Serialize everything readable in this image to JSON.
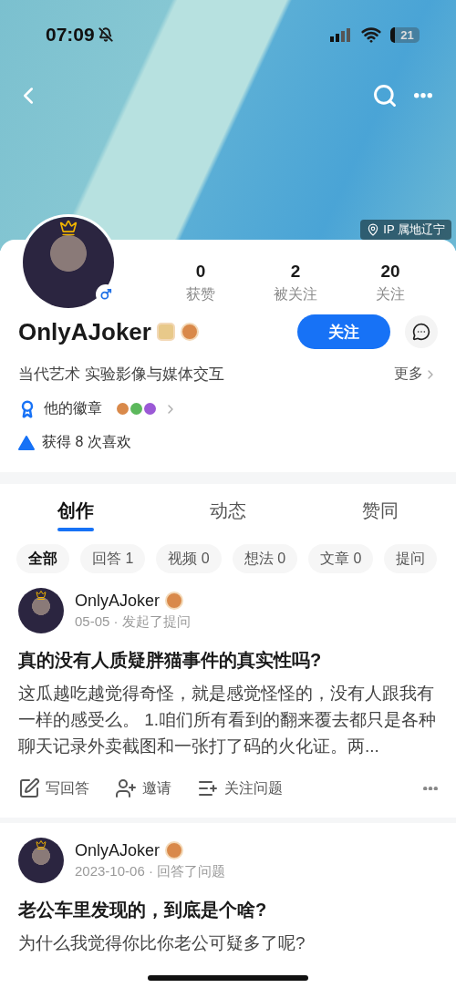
{
  "status_bar": {
    "time": "07:09",
    "battery": "21"
  },
  "ip_location": "IP 属地辽宁",
  "stats": [
    {
      "value": "0",
      "label": "获赞"
    },
    {
      "value": "2",
      "label": "被关注"
    },
    {
      "value": "20",
      "label": "关注"
    }
  ],
  "profile": {
    "name": "OnlyAJoker",
    "follow_button": "关注",
    "bio": "当代艺术 实验影像与媒体交互",
    "more": "更多"
  },
  "badges": {
    "label": "他的徽章",
    "items": [
      {
        "color": "#d9894a"
      },
      {
        "color": "#5cb85c"
      },
      {
        "color": "#9b59d6"
      }
    ]
  },
  "likes": "获得 8 次喜欢",
  "tabs": [
    {
      "label": "创作",
      "selected": true
    },
    {
      "label": "动态",
      "selected": false
    },
    {
      "label": "赞同",
      "selected": false
    }
  ],
  "filters": [
    {
      "label": "全部",
      "selected": true
    },
    {
      "label": "回答 1",
      "selected": false
    },
    {
      "label": "视频 0",
      "selected": false
    },
    {
      "label": "想法 0",
      "selected": false
    },
    {
      "label": "文章 0",
      "selected": false
    },
    {
      "label": "提问",
      "selected": false
    }
  ],
  "posts": [
    {
      "author": "OnlyAJoker",
      "meta": "05-05 · 发起了提问",
      "title": "真的没有人质疑胖猫事件的真实性吗?",
      "body": "这瓜越吃越觉得奇怪，就是感觉怪怪的，没有人跟我有一样的感受么。 1.咱们所有看到的翻来覆去都只是各种聊天记录外卖截图和一张打了码的火化证。两...",
      "actions": [
        {
          "kind": "answer",
          "label": "写回答"
        },
        {
          "kind": "invite",
          "label": "邀请"
        },
        {
          "kind": "follow",
          "label": "关注问题"
        }
      ]
    },
    {
      "author": "OnlyAJoker",
      "meta": "2023-10-06 · 回答了问题",
      "title": "老公车里发现的，到底是个啥?",
      "body": "为什么我觉得你比你老公可疑多了呢?"
    }
  ]
}
